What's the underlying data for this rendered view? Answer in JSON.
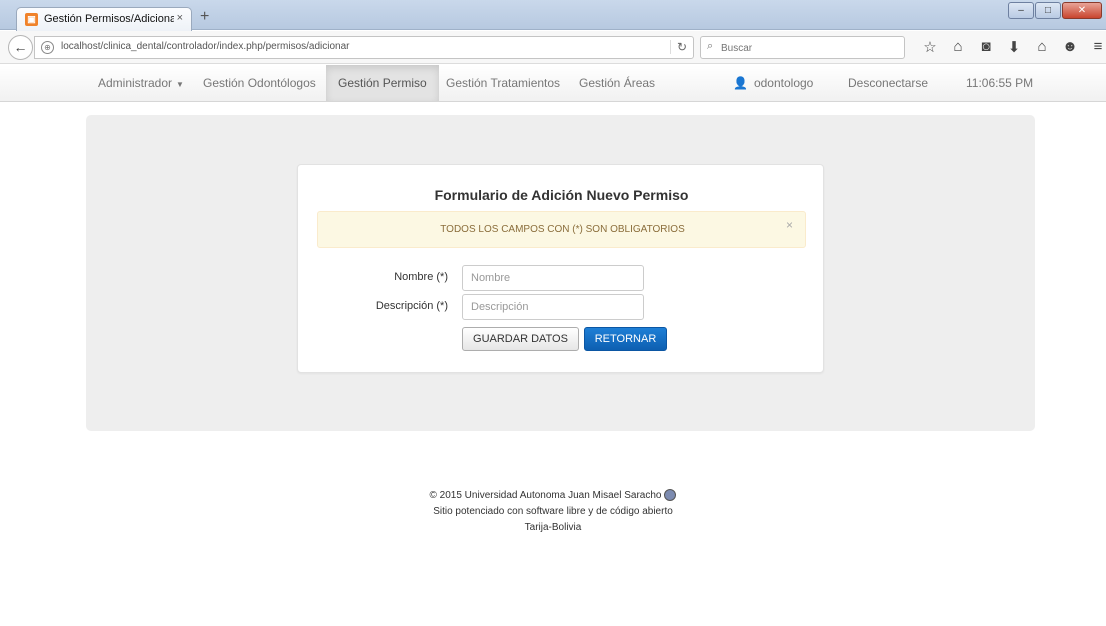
{
  "browser": {
    "tab_title": "Gestión Permisos/Adiciona...",
    "tab_close": "×",
    "new_tab": "+",
    "url": "localhost/clinica_dental/controlador/index.php/permisos/adicionar",
    "search_placeholder": "Buscar",
    "icons": [
      "star-icon",
      "reading-list-icon",
      "pocket-icon",
      "download-icon",
      "home-icon",
      "sync-icon",
      "menu-icon"
    ],
    "window_buttons": [
      "minimize",
      "maximize",
      "close"
    ]
  },
  "sitenav": {
    "admin": "Administrador",
    "odontologos": "Gestión Odontólogos",
    "permisos": "Gestión Permiso",
    "tratamientos": "Gestión Tratamientos",
    "areas": "Gestión Áreas",
    "user": "odontologo",
    "logout": "Desconectarse",
    "clock": "11:06:55 PM"
  },
  "form": {
    "title": "Formulario de Adición Nuevo Permiso",
    "alert": "TODOS LOS CAMPOS CON (*) SON OBLIGATORIOS",
    "alert_close": "×",
    "nombre_label": "Nombre (*)",
    "nombre_placeholder": "Nombre",
    "descripcion_label": "Descripción (*)",
    "descripcion_placeholder": "Descripción",
    "save_button": "GUARDAR DATOS",
    "back_button": "RETORNAR"
  },
  "footer": {
    "line1": "© 2015 Universidad Autonoma Juan Misael Saracho",
    "line2": "Sitio potenciado con software libre y de código abierto",
    "line3": "Tarija-Bolivia"
  },
  "colors": {
    "primary_button": "#0d5fb1",
    "alert_bg": "#fcf8e3",
    "alert_text": "#8a6d3b",
    "panel_bg": "#eeeeee"
  }
}
